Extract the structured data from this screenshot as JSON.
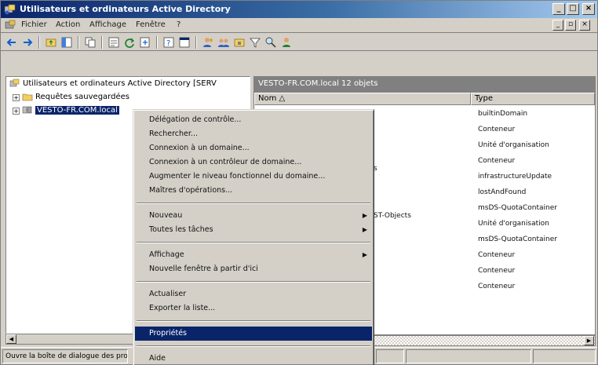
{
  "window": {
    "title": "Utilisateurs et ordinateurs Active Directory",
    "buttons": {
      "minimize": "_",
      "maximize": "□",
      "close": "×"
    }
  },
  "menubar": {
    "items": [
      "Fichier",
      "Action",
      "Affichage",
      "Fenêtre",
      "?"
    ],
    "mdi_buttons": {
      "minimize": "_",
      "restore": "▫",
      "close": "×"
    }
  },
  "tree": {
    "root": "Utilisateurs et ordinateurs Active Directory [SERV",
    "saved_queries": "Requêtes sauvegardées",
    "domain": "VESTO-FR.COM.local"
  },
  "detail": {
    "header": "VESTO-FR.COM.local    12 objets",
    "columns": {
      "name": "Nom",
      "type": "Type"
    },
    "partial_names": [
      "s",
      "ST-Objects"
    ],
    "types": [
      "builtinDomain",
      "Conteneur",
      "Unité d'organisation",
      "Conteneur",
      "infrastructureUpdate",
      "lostAndFound",
      "msDS-QuotaContainer",
      "Unité d'organisation",
      "msDS-QuotaContainer",
      "Conteneur",
      "Conteneur",
      "Conteneur"
    ]
  },
  "context_menu": {
    "items": [
      {
        "label": "Délégation de contrôle...",
        "submenu": false
      },
      {
        "label": "Rechercher...",
        "submenu": false
      },
      {
        "label": "Connexion à un domaine...",
        "submenu": false
      },
      {
        "label": "Connexion à un contrôleur de domaine...",
        "submenu": false
      },
      {
        "label": "Augmenter le niveau fonctionnel du domaine...",
        "submenu": false
      },
      {
        "label": "Maîtres d'opérations...",
        "submenu": false
      },
      {
        "label": "Nouveau",
        "submenu": true
      },
      {
        "label": "Toutes les tâches",
        "submenu": true
      },
      {
        "label": "Affichage",
        "submenu": true
      },
      {
        "label": "Nouvelle fenêtre à partir d'ici",
        "submenu": false
      },
      {
        "label": "Actualiser",
        "submenu": false
      },
      {
        "label": "Exporter la liste...",
        "submenu": false
      },
      {
        "label": "Propriétés",
        "submenu": false
      },
      {
        "label": "Aide",
        "submenu": false
      }
    ],
    "submenu_arrow": "▶"
  },
  "statusbar": {
    "text": "Ouvre la boîte de dialogue des propriétés de la sélection actuelle."
  },
  "colors": {
    "title_start": "#0a246a",
    "title_end": "#a6caf0",
    "selection": "#0a246a",
    "face": "#d4d0c8"
  }
}
